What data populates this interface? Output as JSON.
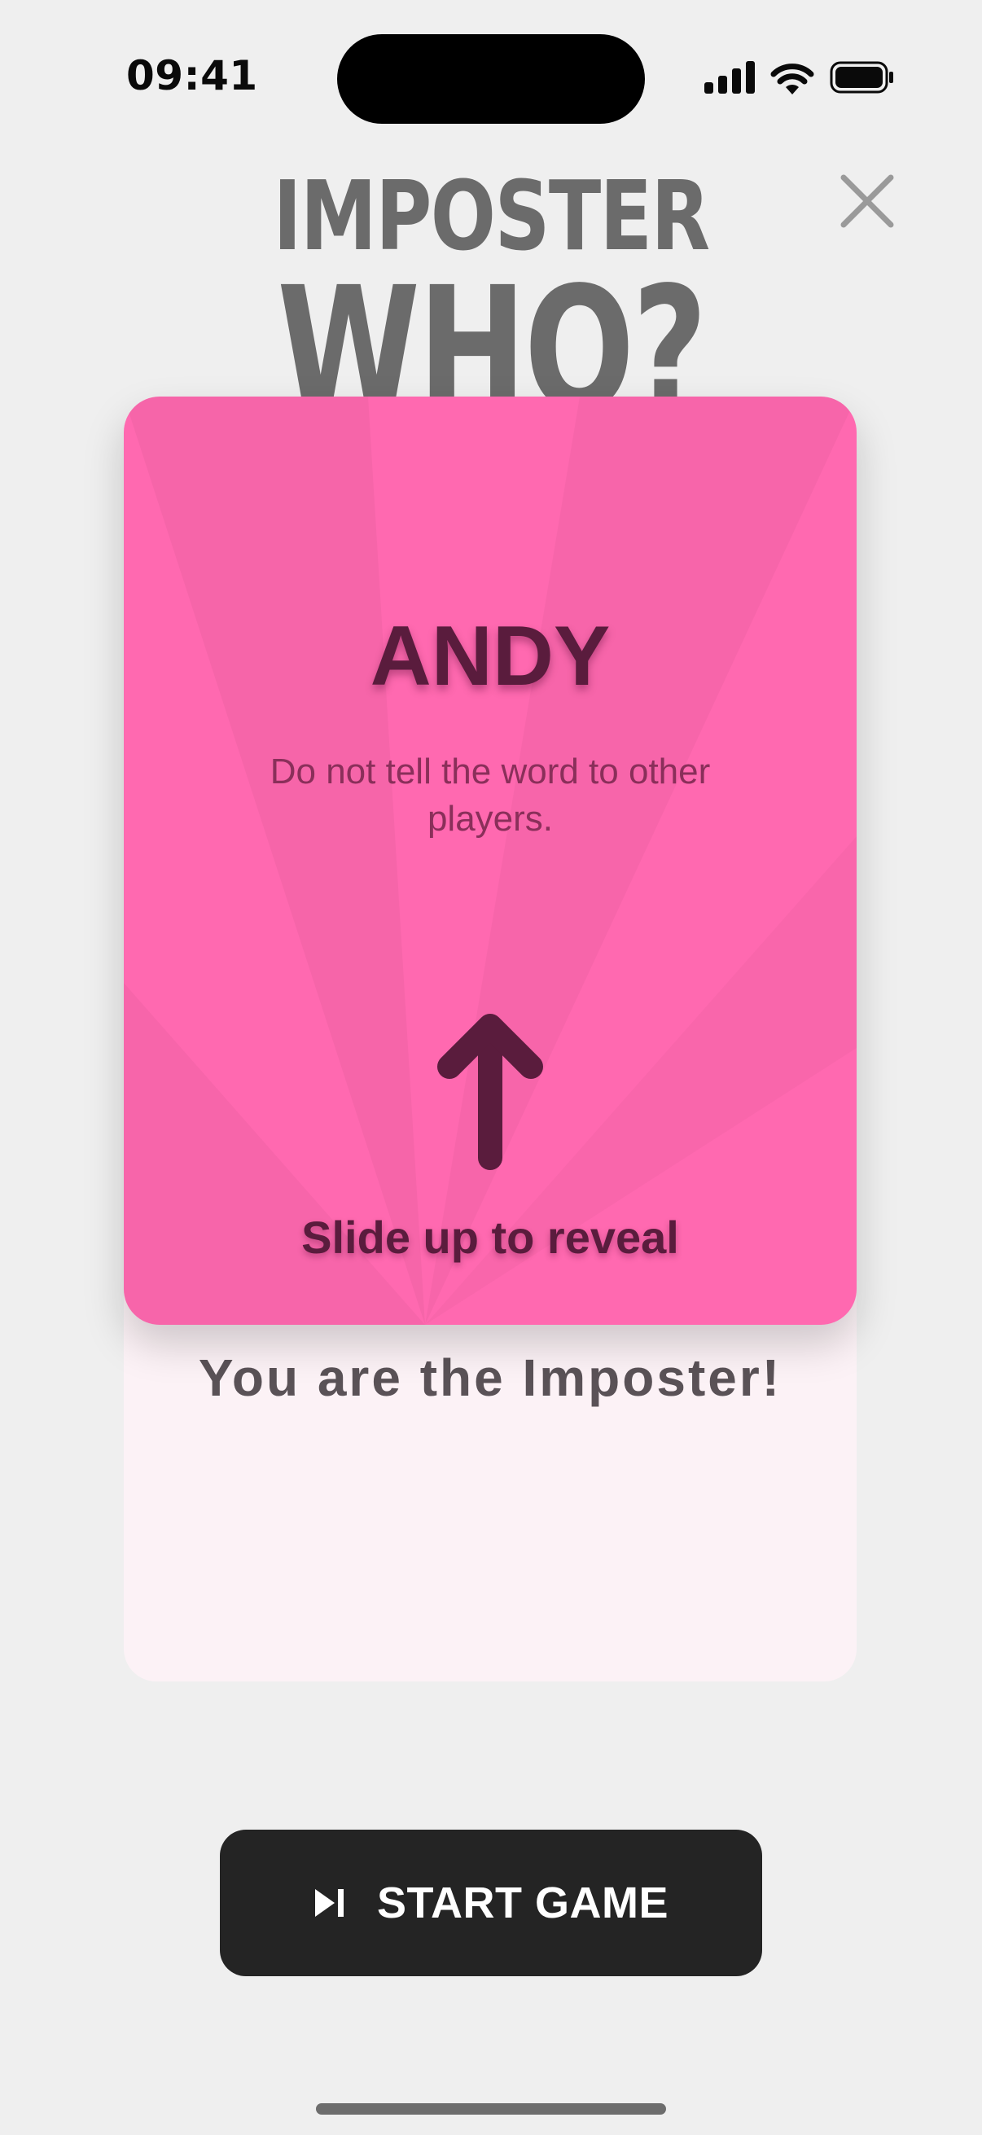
{
  "status_bar": {
    "time": "09:41",
    "icons": [
      "cellular-signal-icon",
      "wifi-icon",
      "battery-icon"
    ]
  },
  "header": {
    "title_line1": "IMPOSTER",
    "title_line2": "WHO?",
    "close_icon": "close-icon"
  },
  "card": {
    "player_name": "ANDY",
    "hint": "Do not tell the word to other players.",
    "arrow_icon": "arrow-up-icon",
    "slide_label": "Slide up to reveal",
    "color": "#ff69b0"
  },
  "reveal": {
    "text": "You are the Imposter!"
  },
  "start_button": {
    "icon": "skip-next-icon",
    "label": "START GAME"
  },
  "colors": {
    "background": "#efefef",
    "button": "#242424",
    "title": "#6b6b6b"
  }
}
